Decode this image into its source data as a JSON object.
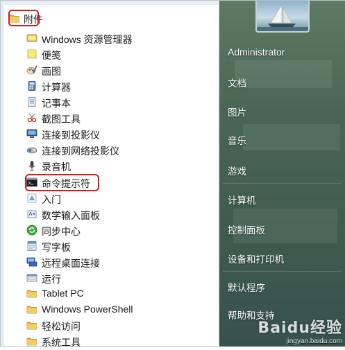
{
  "menu": {
    "folder_title": "附件",
    "items": [
      {
        "label": "Windows 资源管理器",
        "icon": "explorer-icon"
      },
      {
        "label": "便笺",
        "icon": "sticky-notes-icon"
      },
      {
        "label": "画图",
        "icon": "paint-icon"
      },
      {
        "label": "计算器",
        "icon": "calculator-icon"
      },
      {
        "label": "记事本",
        "icon": "notepad-icon"
      },
      {
        "label": "截图工具",
        "icon": "snipping-tool-icon"
      },
      {
        "label": "连接到投影仪",
        "icon": "projector-icon"
      },
      {
        "label": "连接到网络投影仪",
        "icon": "network-projector-icon"
      },
      {
        "label": "录音机",
        "icon": "microphone-icon"
      },
      {
        "label": "命令提示符",
        "icon": "command-prompt-icon"
      },
      {
        "label": "入门",
        "icon": "getting-started-icon"
      },
      {
        "label": "数学输入面板",
        "icon": "math-input-icon"
      },
      {
        "label": "同步中心",
        "icon": "sync-center-icon"
      },
      {
        "label": "写字板",
        "icon": "wordpad-icon"
      },
      {
        "label": "远程桌面连接",
        "icon": "remote-desktop-icon"
      },
      {
        "label": "运行",
        "icon": "run-icon"
      },
      {
        "label": "Tablet PC",
        "icon": "folder-icon"
      },
      {
        "label": "Windows PowerShell",
        "icon": "folder-icon"
      },
      {
        "label": "轻松访问",
        "icon": "folder-icon"
      },
      {
        "label": "系统工具",
        "icon": "folder-icon"
      }
    ]
  },
  "right_pane": {
    "user": "Administrator",
    "items": [
      "文档",
      "图片",
      "音乐",
      "游戏",
      "计算机",
      "控制面板",
      "设备和打印机",
      "默认程序",
      "帮助和支持"
    ]
  },
  "watermark": {
    "brand": "Baidu经验",
    "site": "jingyan.baidu.com"
  }
}
